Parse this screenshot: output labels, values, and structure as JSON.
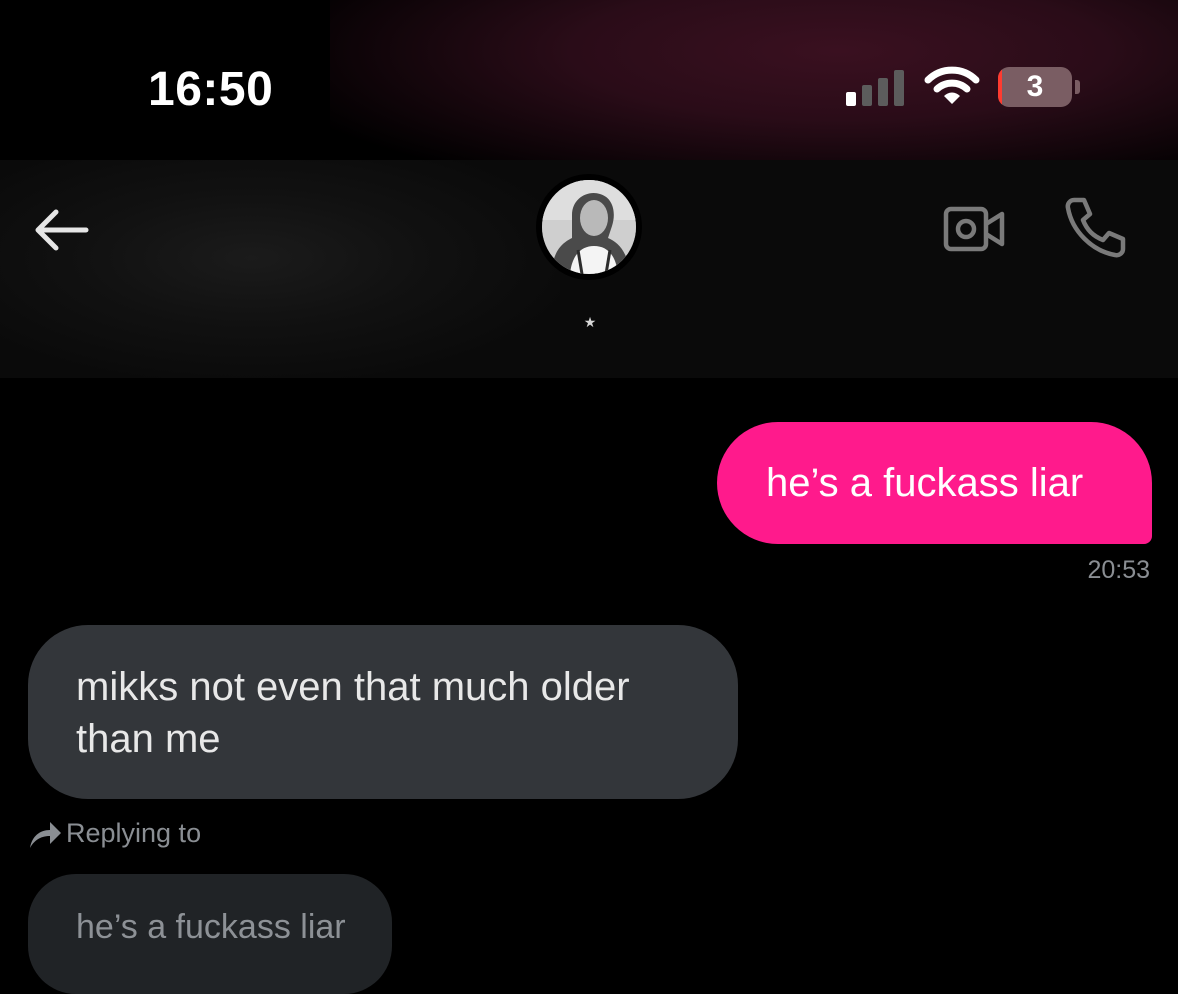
{
  "status_bar": {
    "time": "16:50",
    "signal_icon": "cellular-signal-icon",
    "wifi_icon": "wifi-icon",
    "battery_level": "3",
    "battery_icon": "battery-icon"
  },
  "header": {
    "back_icon": "arrow-left-icon",
    "avatar_icon": "profile-avatar",
    "contact_name": "★",
    "video_icon": "video-camera-icon",
    "call_icon": "phone-icon"
  },
  "messages": {
    "sent": {
      "text": "he’s a fuckass liar",
      "time": "20:53"
    },
    "received": {
      "line1": "mikks not even that much older",
      "line2": "than me"
    },
    "reply": {
      "icon": "reply-arrow-icon",
      "label": "Replying to",
      "quoted_text": "he’s a fuckass liar"
    }
  },
  "colors": {
    "sent_bubble": "#ff1a8c",
    "received_bubble": "#33363a",
    "background": "#000000",
    "muted_text": "#8a8e93"
  }
}
